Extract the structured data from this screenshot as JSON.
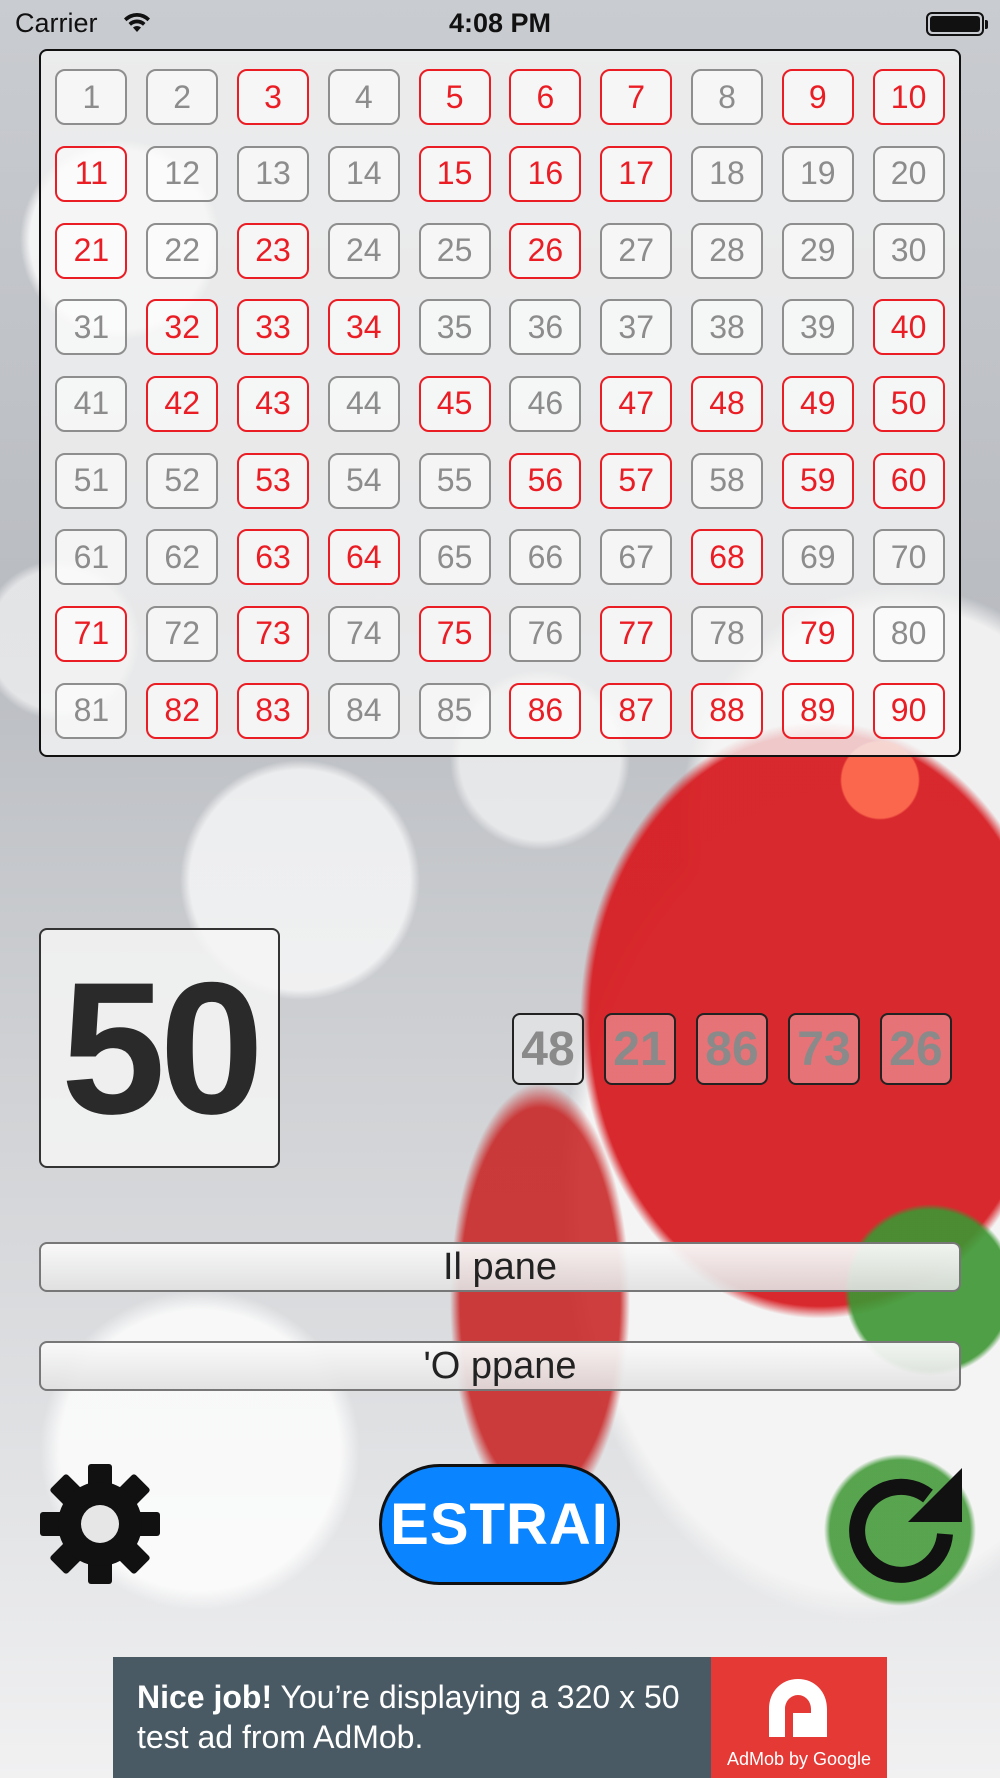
{
  "status_bar": {
    "carrier": "Carrier",
    "time": "4:08 PM"
  },
  "board": {
    "numbers": [
      {
        "n": "1",
        "drawn": false
      },
      {
        "n": "2",
        "drawn": false
      },
      {
        "n": "3",
        "drawn": true
      },
      {
        "n": "4",
        "drawn": false
      },
      {
        "n": "5",
        "drawn": true
      },
      {
        "n": "6",
        "drawn": true
      },
      {
        "n": "7",
        "drawn": true
      },
      {
        "n": "8",
        "drawn": false
      },
      {
        "n": "9",
        "drawn": true
      },
      {
        "n": "10",
        "drawn": true
      },
      {
        "n": "11",
        "drawn": true
      },
      {
        "n": "12",
        "drawn": false
      },
      {
        "n": "13",
        "drawn": false
      },
      {
        "n": "14",
        "drawn": false
      },
      {
        "n": "15",
        "drawn": true
      },
      {
        "n": "16",
        "drawn": true
      },
      {
        "n": "17",
        "drawn": true
      },
      {
        "n": "18",
        "drawn": false
      },
      {
        "n": "19",
        "drawn": false
      },
      {
        "n": "20",
        "drawn": false
      },
      {
        "n": "21",
        "drawn": true
      },
      {
        "n": "22",
        "drawn": false
      },
      {
        "n": "23",
        "drawn": true
      },
      {
        "n": "24",
        "drawn": false
      },
      {
        "n": "25",
        "drawn": false
      },
      {
        "n": "26",
        "drawn": true
      },
      {
        "n": "27",
        "drawn": false
      },
      {
        "n": "28",
        "drawn": false
      },
      {
        "n": "29",
        "drawn": false
      },
      {
        "n": "30",
        "drawn": false
      },
      {
        "n": "31",
        "drawn": false
      },
      {
        "n": "32",
        "drawn": true
      },
      {
        "n": "33",
        "drawn": true
      },
      {
        "n": "34",
        "drawn": true
      },
      {
        "n": "35",
        "drawn": false
      },
      {
        "n": "36",
        "drawn": false
      },
      {
        "n": "37",
        "drawn": false
      },
      {
        "n": "38",
        "drawn": false
      },
      {
        "n": "39",
        "drawn": false
      },
      {
        "n": "40",
        "drawn": true
      },
      {
        "n": "41",
        "drawn": false
      },
      {
        "n": "42",
        "drawn": true
      },
      {
        "n": "43",
        "drawn": true
      },
      {
        "n": "44",
        "drawn": false
      },
      {
        "n": "45",
        "drawn": true
      },
      {
        "n": "46",
        "drawn": false
      },
      {
        "n": "47",
        "drawn": true
      },
      {
        "n": "48",
        "drawn": true
      },
      {
        "n": "49",
        "drawn": true
      },
      {
        "n": "50",
        "drawn": true
      },
      {
        "n": "51",
        "drawn": false
      },
      {
        "n": "52",
        "drawn": false
      },
      {
        "n": "53",
        "drawn": true
      },
      {
        "n": "54",
        "drawn": false
      },
      {
        "n": "55",
        "drawn": false
      },
      {
        "n": "56",
        "drawn": true
      },
      {
        "n": "57",
        "drawn": true
      },
      {
        "n": "58",
        "drawn": false
      },
      {
        "n": "59",
        "drawn": true
      },
      {
        "n": "60",
        "drawn": true
      },
      {
        "n": "61",
        "drawn": false
      },
      {
        "n": "62",
        "drawn": false
      },
      {
        "n": "63",
        "drawn": true
      },
      {
        "n": "64",
        "drawn": true
      },
      {
        "n": "65",
        "drawn": false
      },
      {
        "n": "66",
        "drawn": false
      },
      {
        "n": "67",
        "drawn": false
      },
      {
        "n": "68",
        "drawn": true
      },
      {
        "n": "69",
        "drawn": false
      },
      {
        "n": "70",
        "drawn": false
      },
      {
        "n": "71",
        "drawn": true
      },
      {
        "n": "72",
        "drawn": false
      },
      {
        "n": "73",
        "drawn": true
      },
      {
        "n": "74",
        "drawn": false
      },
      {
        "n": "75",
        "drawn": true
      },
      {
        "n": "76",
        "drawn": false
      },
      {
        "n": "77",
        "drawn": true
      },
      {
        "n": "78",
        "drawn": false
      },
      {
        "n": "79",
        "drawn": true
      },
      {
        "n": "80",
        "drawn": false
      },
      {
        "n": "81",
        "drawn": false
      },
      {
        "n": "82",
        "drawn": true
      },
      {
        "n": "83",
        "drawn": true
      },
      {
        "n": "84",
        "drawn": false
      },
      {
        "n": "85",
        "drawn": false
      },
      {
        "n": "86",
        "drawn": true
      },
      {
        "n": "87",
        "drawn": true
      },
      {
        "n": "88",
        "drawn": true
      },
      {
        "n": "89",
        "drawn": true
      },
      {
        "n": "90",
        "drawn": true
      }
    ],
    "drawn_color": "#ea1d25",
    "undrawn_color": "#8c8c8c"
  },
  "current": {
    "number": "50"
  },
  "recent": [
    "48",
    "21",
    "86",
    "73",
    "26"
  ],
  "meaning": {
    "italian": "Il pane",
    "neapolitan": "'O ppane"
  },
  "controls": {
    "settings_icon": "gear-icon",
    "draw_label": "ESTRAI",
    "draw_color": "#0a84ff",
    "restart_icon": "restart-icon"
  },
  "ad": {
    "headline": "Nice job!",
    "body": " You’re displaying a 320 x 50 test ad from AdMob.",
    "logo_text": "AdMob by Google",
    "logo_color": "#e53935"
  }
}
